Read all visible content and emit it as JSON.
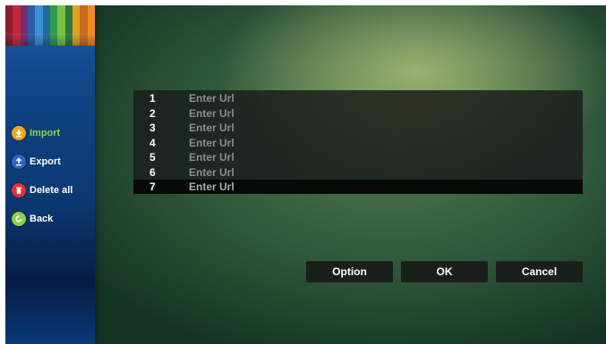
{
  "sidebar": {
    "pencil_colors": [
      "#8b1d2c",
      "#c2283a",
      "#7a2a6d",
      "#2c5aa8",
      "#3a8fd6",
      "#1f6b9a",
      "#2e9b4a",
      "#79c043",
      "#2f7a3a",
      "#e0a020",
      "#c76a1e",
      "#f08a24"
    ],
    "items": [
      {
        "label": "Import",
        "icon": "import-icon",
        "color": "#f3a51c",
        "active": true
      },
      {
        "label": "Export",
        "icon": "export-icon",
        "color": "#2a66c8",
        "active": false
      },
      {
        "label": "Delete all",
        "icon": "trash-icon",
        "color": "#e23232",
        "active": false
      },
      {
        "label": "Back",
        "icon": "back-icon",
        "color": "#8fcf4a",
        "active": false
      }
    ]
  },
  "url_list": {
    "rows": [
      {
        "num": "1",
        "placeholder": "Enter Url"
      },
      {
        "num": "2",
        "placeholder": "Enter Url"
      },
      {
        "num": "3",
        "placeholder": "Enter Url"
      },
      {
        "num": "4",
        "placeholder": "Enter Url"
      },
      {
        "num": "5",
        "placeholder": "Enter Url"
      },
      {
        "num": "6",
        "placeholder": "Enter Url"
      },
      {
        "num": "7",
        "placeholder": "Enter Url"
      }
    ],
    "selected_index": 6
  },
  "buttons": {
    "option": "Option",
    "ok": "OK",
    "cancel": "Cancel"
  }
}
